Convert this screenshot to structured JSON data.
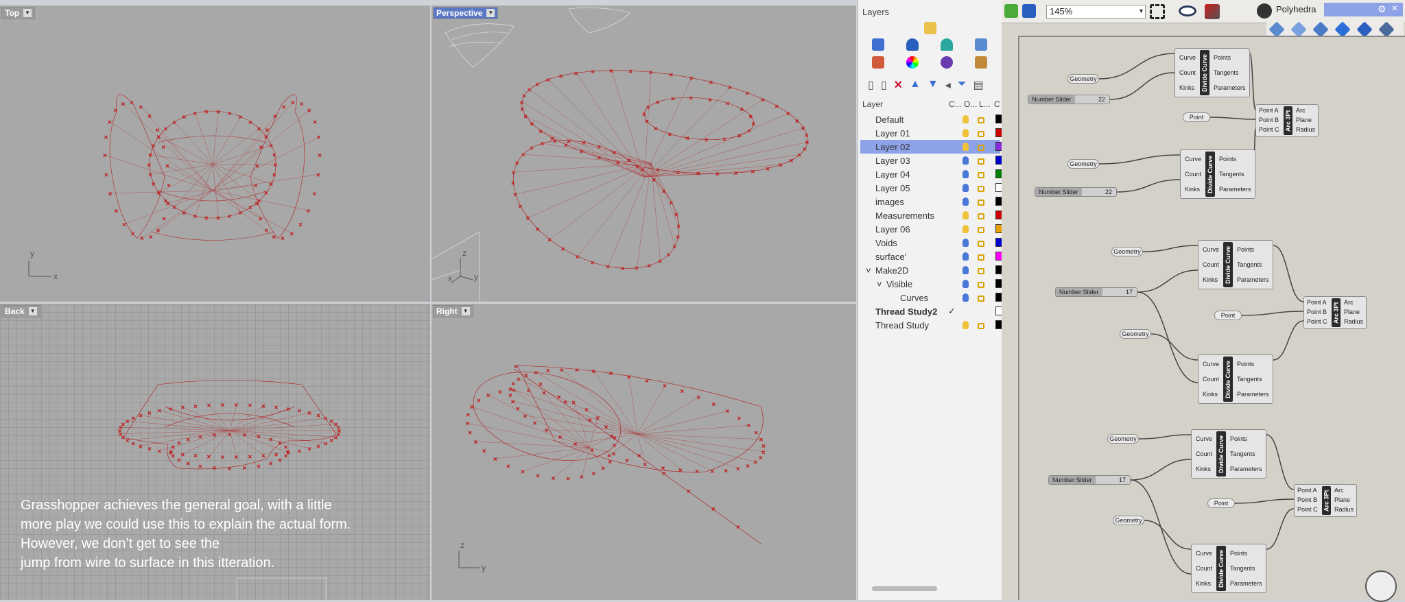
{
  "viewports": {
    "top": {
      "label": "Top",
      "axis_y": "y",
      "axis_x": "x"
    },
    "perspective": {
      "label": "Perspective",
      "axis_z": "z",
      "axis_y": "y",
      "axis_x": "x"
    },
    "back": {
      "label": "Back",
      "axis_x": "x"
    },
    "right": {
      "label": "Right",
      "axis_z": "z",
      "axis_y": "y"
    }
  },
  "caption": {
    "line1": "Grasshopper achieves the general goal, with a little",
    "line2": "more play we could use this to explain the actual form.",
    "line3": "However, we don’t get to see the",
    "line4": "jump from wire to surface in this itteration."
  },
  "layers": {
    "title": "Layers",
    "header": {
      "name": "Layer",
      "current": "C...",
      "on": "O...",
      "lock": "L...",
      "color": "C"
    },
    "rows": [
      {
        "name": "Default",
        "bulb": "yellow",
        "color": "#000000"
      },
      {
        "name": "Layer 01",
        "bulb": "yellow",
        "color": "#cc0000"
      },
      {
        "name": "Layer 02",
        "bulb": "yellow",
        "color": "#8a2be2",
        "selected": true
      },
      {
        "name": "Layer 03",
        "bulb": "blue",
        "color": "#0000cc"
      },
      {
        "name": "Layer 04",
        "bulb": "blue",
        "color": "#008000"
      },
      {
        "name": "Layer 05",
        "bulb": "blue",
        "color": "#ffffff"
      },
      {
        "name": "images",
        "bulb": "blue",
        "color": "#000000"
      },
      {
        "name": "Measurements",
        "bulb": "yellow",
        "color": "#cc0000"
      },
      {
        "name": "Layer 06",
        "bulb": "yellow",
        "color": "#e8a000"
      },
      {
        "name": "Voids",
        "bulb": "blue",
        "color": "#0000cc"
      },
      {
        "name": "surface'",
        "bulb": "blue",
        "color": "#ff00ff"
      },
      {
        "name": "Make2D",
        "bulb": "blue",
        "color": "#000000",
        "expander": "˅"
      },
      {
        "name": "Visible",
        "bulb": "blue",
        "color": "#000000",
        "expander": "˅"
      },
      {
        "name": "Curves",
        "bulb": "blue",
        "color": "#000000"
      },
      {
        "name": "Thread Study2",
        "bulb": "none",
        "color": "#ffffff",
        "bold": true,
        "check": "✓"
      },
      {
        "name": "Thread Study",
        "bulb": "yellow",
        "color": "#000000"
      }
    ]
  },
  "grasshopper": {
    "zoom": "145%",
    "tab": "Polyhedra",
    "components": {
      "divide_label": "Divide Curve",
      "arc_label": "Arc 3Pt",
      "inputs": [
        "Curve",
        "Count",
        "Kinks"
      ],
      "outputs": [
        "Points",
        "Tangents",
        "Parameters"
      ],
      "arc_inputs": [
        "Point A",
        "Point B",
        "Point C"
      ],
      "arc_outputs": [
        "Arc",
        "Plane",
        "Radius"
      ]
    },
    "geometry_label": "Geometry",
    "point_label": "Point",
    "slider_label": "Number Slider",
    "slider_values": [
      "22",
      "22",
      "17",
      "17"
    ]
  }
}
